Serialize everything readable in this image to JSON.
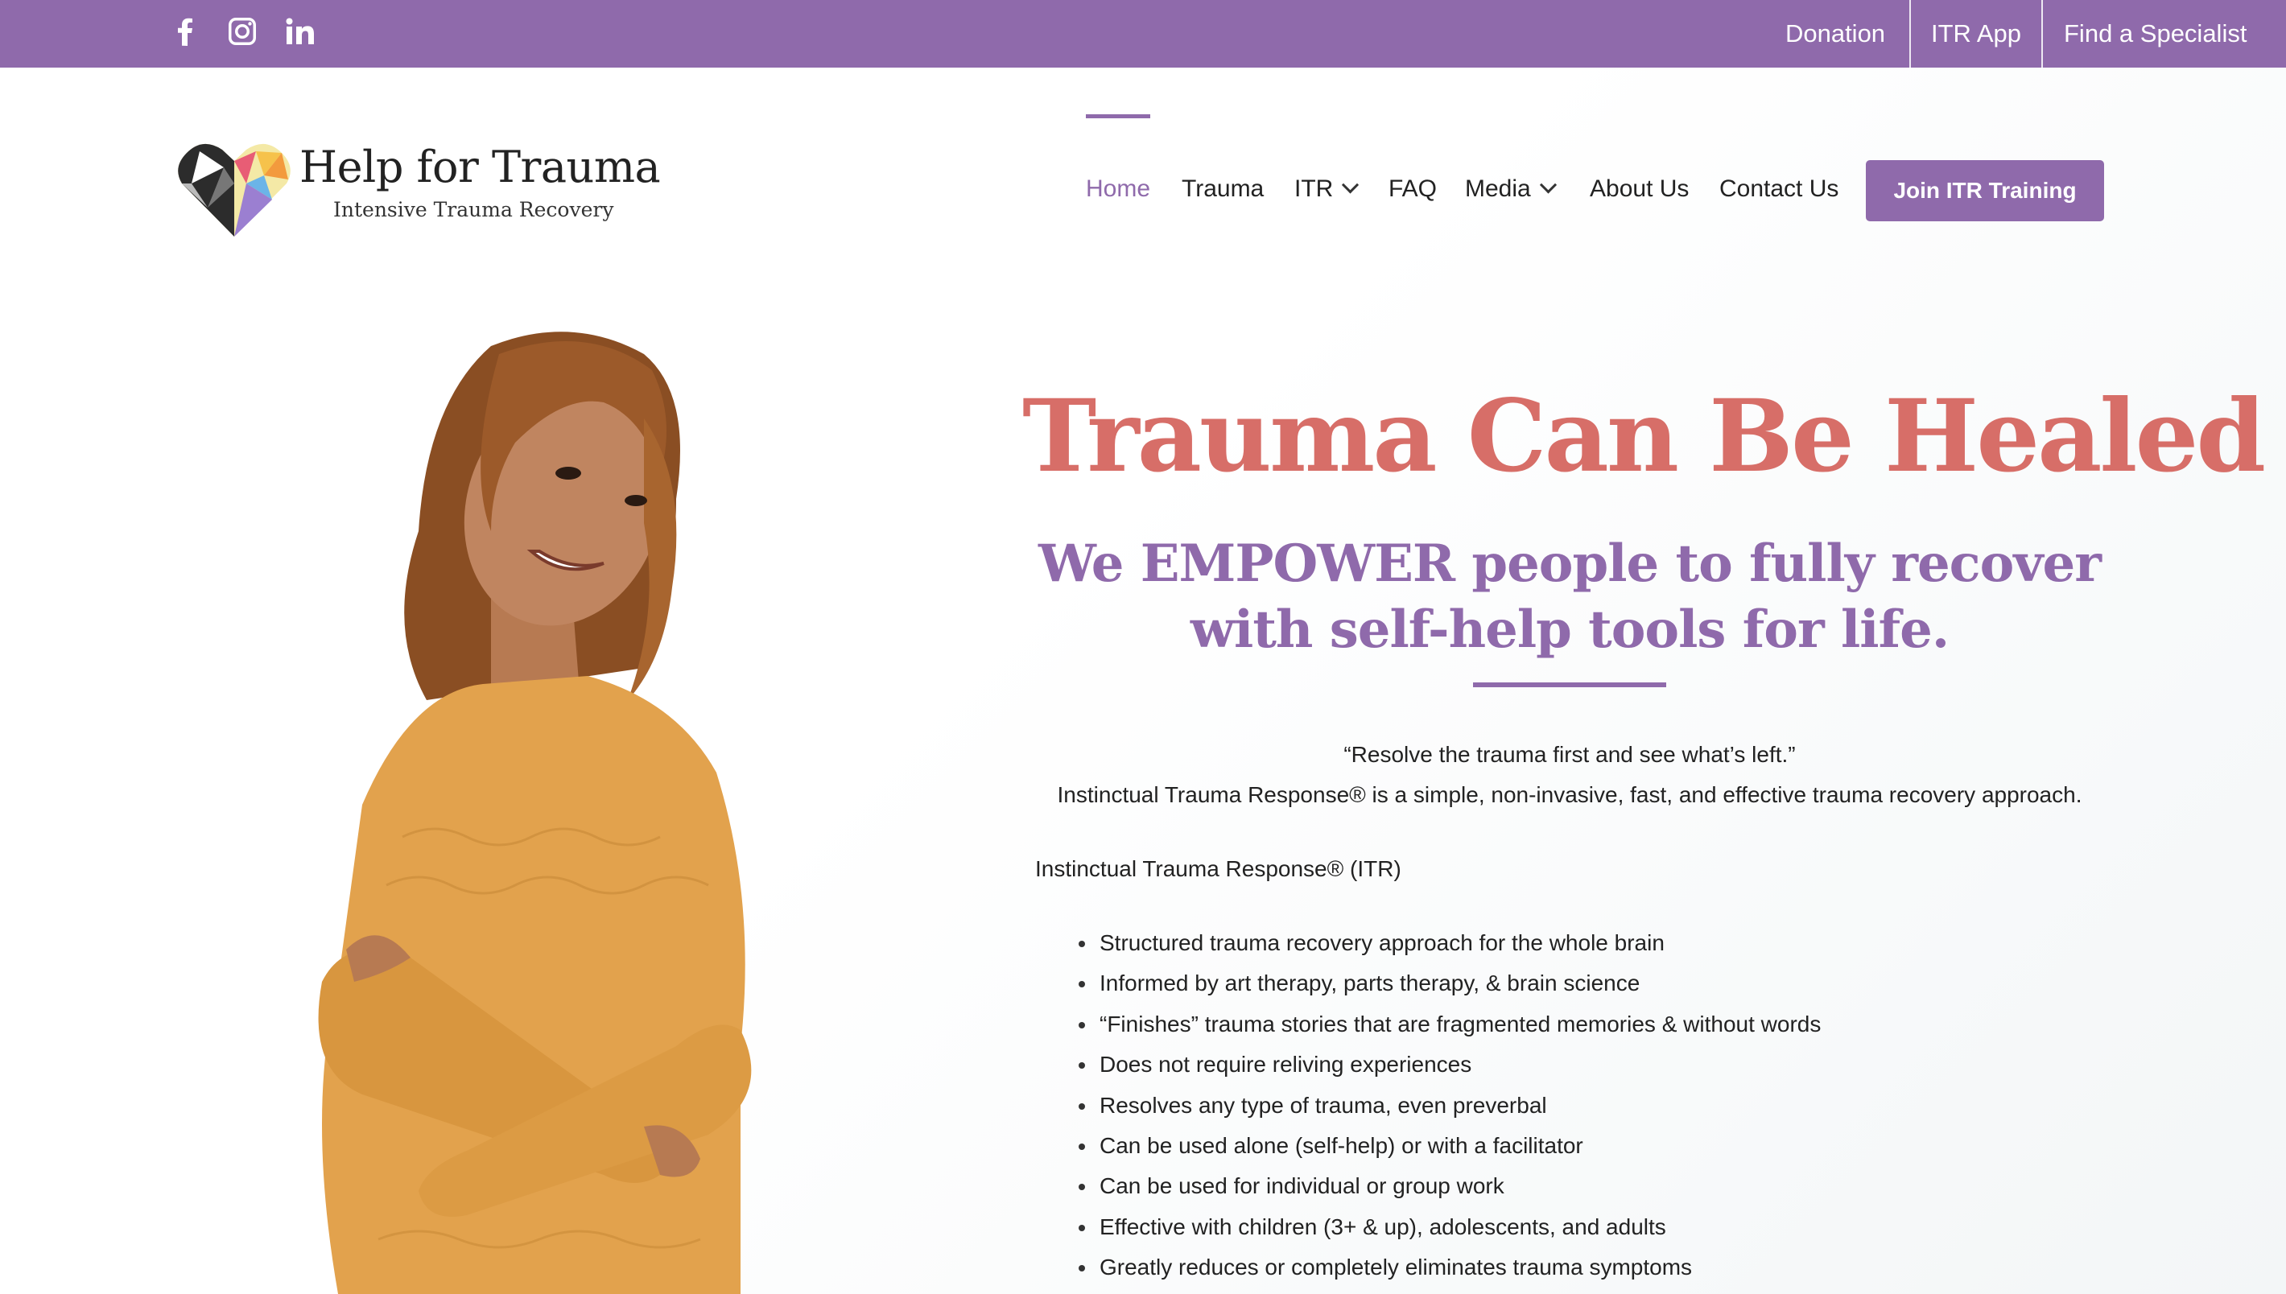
{
  "topbar": {
    "background": "#8f6aab",
    "social": [
      {
        "icon": "facebook-icon"
      },
      {
        "icon": "instagram-icon"
      },
      {
        "icon": "linkedin-icon"
      }
    ],
    "links": [
      "Donation",
      "ITR App",
      "Find a Specialist"
    ]
  },
  "logo": {
    "title": "Help for Trauma",
    "subtitle": "Intensive Trauma Recovery"
  },
  "nav": {
    "items": [
      {
        "label": "Home",
        "active": true
      },
      {
        "label": "Trauma"
      },
      {
        "label": "ITR",
        "dropdown": true
      },
      {
        "label": "FAQ"
      },
      {
        "label": "Media",
        "dropdown": true
      },
      {
        "label": "About Us"
      },
      {
        "label": "Contact Us"
      }
    ],
    "cta": "Join ITR Training"
  },
  "hero": {
    "title": "Trauma Can Be Healed",
    "subtitle": "We EMPOWER people to fully recover with self-help tools for life.",
    "quote": "“Resolve the trauma first and see what’s left.”",
    "description": "Instinctual Trauma Response® is a simple, non-invasive, fast, and effective trauma recovery approach.",
    "list_title": "Instinctual Trauma Response® (ITR)",
    "bullets": [
      "Structured trauma recovery approach for the whole brain",
      "Informed by art therapy, parts therapy, & brain science",
      "“Finishes” trauma stories that are fragmented memories & without words",
      "Does not require reliving experiences",
      "Resolves any type of trauma, even preverbal",
      "Can be used alone (self-help) or with a facilitator",
      "Can be used for individual or group work",
      "Effective with children (3+ & up), adolescents, and adults",
      "Greatly reduces or completely eliminates trauma symptoms"
    ]
  },
  "colors": {
    "accent": "#8f6aab",
    "title": "#d76e68"
  }
}
